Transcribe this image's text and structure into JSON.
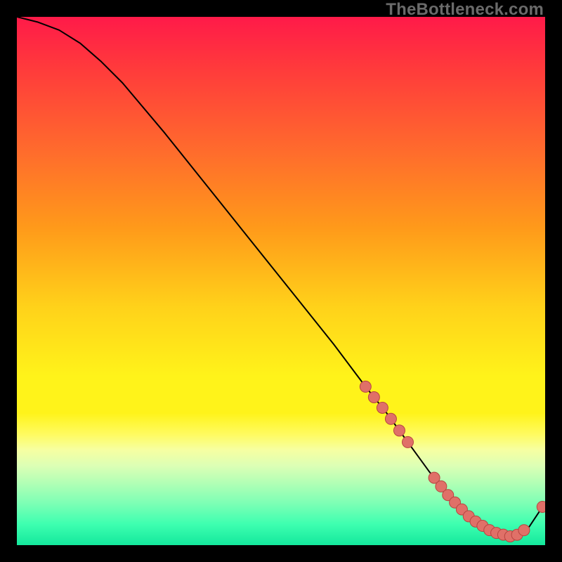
{
  "watermark": "TheBottleneck.com",
  "chart_data": {
    "type": "line",
    "title": "",
    "xlabel": "",
    "ylabel": "",
    "xlim": [
      0,
      100
    ],
    "ylim": [
      0,
      100
    ],
    "series": [
      {
        "name": "curve",
        "x": [
          0,
          4,
          8,
          12,
          16,
          20,
          28,
          36,
          44,
          52,
          60,
          66,
          70,
          74,
          78,
          82,
          86,
          90,
          94,
          97,
          100
        ],
        "y": [
          100,
          99,
          97.5,
          95,
          91.5,
          87.5,
          78,
          68,
          58,
          48,
          38,
          30,
          25,
          19.5,
          14,
          9,
          5,
          2.5,
          1.5,
          3.5,
          8
        ]
      }
    ],
    "highlight_clusters": [
      {
        "x_range": [
          66,
          74
        ],
        "y_range": [
          19,
          30
        ],
        "count": 6
      },
      {
        "x_range": [
          79,
          96
        ],
        "y_range": [
          1.3,
          3.5
        ],
        "count": 14
      },
      {
        "x_range": [
          99,
          100
        ],
        "y_range": [
          7,
          8.5
        ],
        "count": 1
      }
    ],
    "colors": {
      "curve": "#000000",
      "marker_fill": "#e07068",
      "marker_stroke": "#b74540",
      "gradient_top": "#ff1a49",
      "gradient_bottom": "#14e89c"
    }
  }
}
